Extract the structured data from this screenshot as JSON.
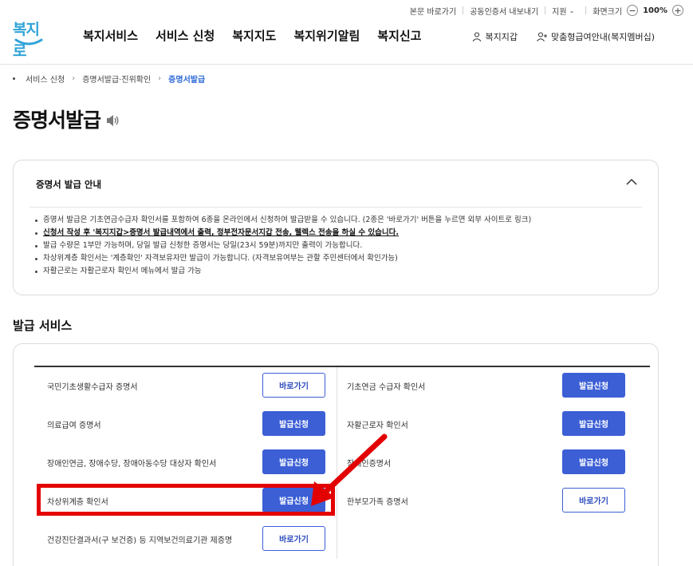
{
  "utility": {
    "skip": "본문 바로가기",
    "cert": "공동인증서 내보내기",
    "support": "지원",
    "zoom_label": "화면크기",
    "zoom_minus": "−",
    "zoom_value": "100%",
    "zoom_plus": "+"
  },
  "logo": {
    "text": "복지로"
  },
  "nav": [
    "복지서비스",
    "서비스 신청",
    "복지지도",
    "복지위기알림",
    "복지신고"
  ],
  "header_right": {
    "wallet": "복지지갑",
    "membership": "맞춤형급여안내(복지멤버십)"
  },
  "breadcrumb": [
    "서비스 신청",
    "증명서발급·진위확인",
    "증명서발급"
  ],
  "page_title": "증명서발급",
  "info": {
    "title": "증명서 발급 안내",
    "items": [
      "증명서 발급은 기초연금수급자 확인서를 포함하여 6종을 온라인에서 신청하여 발급받을 수 있습니다. (2종은 '바로가기' 버튼을 누르면 외부 사이트로 링크)",
      "신청서 작성 후 '복지지갑>증명서 발급내역에서 출력, 정부전자문서지갑 전송, 웰렉스 전송을 하실 수 있습니다.",
      "발급 수량은 1부만 가능하며, 당일 발급 신청한 증명서는 당일(23시 59분)까지만 출력이 가능합니다.",
      "차상위계층 확인서는 '계층확인' 자격보유자만 발급이 가능합니다. (자격보유여부는 관할 주민센터에서 확인가능)",
      "자활근로는 자활근로자 확인서 메뉴에서 발급 가능"
    ]
  },
  "section_title": "발급 서비스",
  "services_left": [
    {
      "label": "국민기초생활수급자 증명서",
      "button": "바로가기",
      "style": "line"
    },
    {
      "label": "의료급여 증명서",
      "button": "발급신청",
      "style": "fill"
    },
    {
      "label": "장애인연금, 장애수당, 장애아동수당 대상자 확인서",
      "button": "발급신청",
      "style": "fill"
    },
    {
      "label": "차상위계층 확인서",
      "button": "발급신청",
      "style": "fill"
    },
    {
      "label": "건강진단결과서(구 보건증) 등 지역보건의료기관 제증명",
      "button": "바로가기",
      "style": "line"
    }
  ],
  "services_right": [
    {
      "label": "기초연금 수급자 확인서",
      "button": "발급신청",
      "style": "fill"
    },
    {
      "label": "자활근로자 확인서",
      "button": "발급신청",
      "style": "fill"
    },
    {
      "label": "장애인증명서",
      "button": "발급신청",
      "style": "fill"
    },
    {
      "label": "한부모가족 증명서",
      "button": "바로가기",
      "style": "line"
    }
  ],
  "colors": {
    "primary": "#3c5fd6",
    "highlight": "#e30000",
    "logo": "#2fa3d8"
  }
}
